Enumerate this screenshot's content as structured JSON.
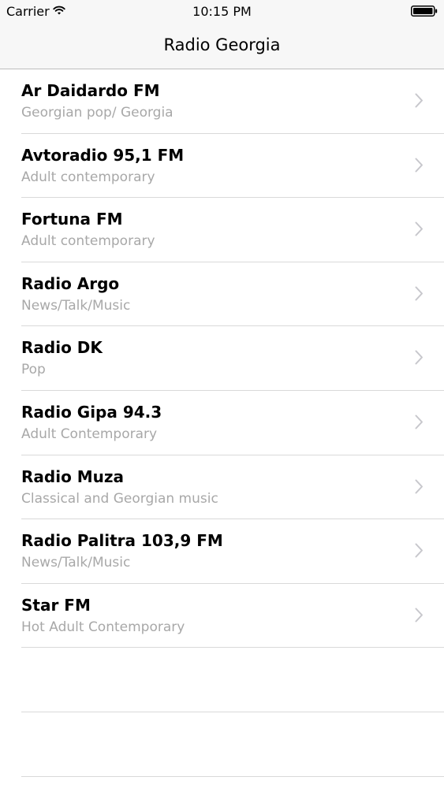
{
  "status_bar": {
    "carrier": "Carrier",
    "time": "10:15 PM",
    "wifi_icon": "wifi-icon",
    "battery_icon": "battery-icon"
  },
  "nav": {
    "title": "Radio Georgia"
  },
  "stations": [
    {
      "name": "Ar Daidardo FM",
      "genre": "Georgian pop/ Georgia"
    },
    {
      "name": "Avtoradio 95,1 FM",
      "genre": "Adult contemporary"
    },
    {
      "name": "Fortuna FM",
      "genre": "Adult contemporary"
    },
    {
      "name": "Radio Argo",
      "genre": "News/Talk/Music"
    },
    {
      "name": "Radio DK",
      "genre": "Pop"
    },
    {
      "name": "Radio Gipa 94.3",
      "genre": "Adult Contemporary"
    },
    {
      "name": "Radio Muza",
      "genre": "Classical and Georgian music"
    },
    {
      "name": "Radio Palitra 103,9 FM",
      "genre": "News/Talk/Music"
    },
    {
      "name": "Star FM",
      "genre": "Hot Adult Contemporary"
    }
  ],
  "icons": {
    "disclosure": "chevron-right-icon"
  },
  "colors": {
    "bar_background": "#f7f7f7",
    "subtitle": "#a8a8a8",
    "separator": "#d9d9d9",
    "chevron": "#c7c7cc"
  }
}
